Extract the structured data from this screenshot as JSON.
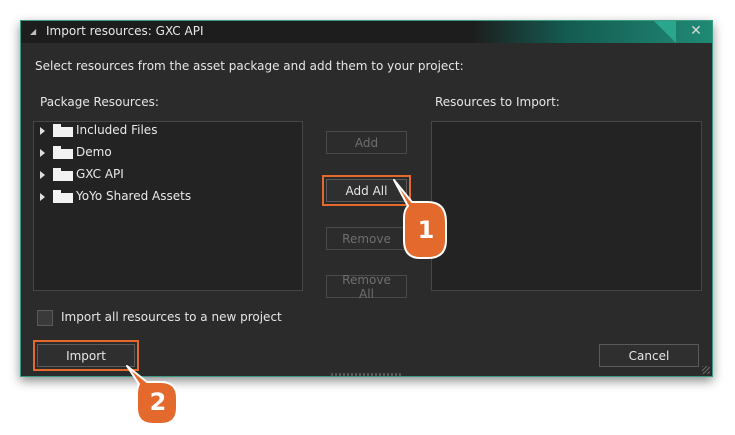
{
  "window": {
    "title": "Import resources: GXC API"
  },
  "instruction": "Select resources from the asset package and add them to your project:",
  "package_resources": {
    "label": "Package Resources:",
    "items": [
      {
        "label": "Included Files",
        "icon": "folder-icon"
      },
      {
        "label": "Demo",
        "icon": "folder-icon"
      },
      {
        "label": "GXC API",
        "icon": "folder-icon"
      },
      {
        "label": "YoYo Shared Assets",
        "icon": "folder-icon"
      }
    ]
  },
  "resources_to_import": {
    "label": "Resources to Import:"
  },
  "buttons": {
    "add": "Add",
    "add_all": "Add All",
    "remove": "Remove",
    "remove_all": "Remove All",
    "import": "Import",
    "cancel": "Cancel",
    "close": "✕"
  },
  "checkbox": {
    "label": "Import all resources to a new project",
    "checked": false
  },
  "callouts": [
    "1",
    "2"
  ],
  "colors": {
    "highlight": "#e36a2c",
    "accent": "#1f8a75",
    "background": "#2b2b2b"
  }
}
